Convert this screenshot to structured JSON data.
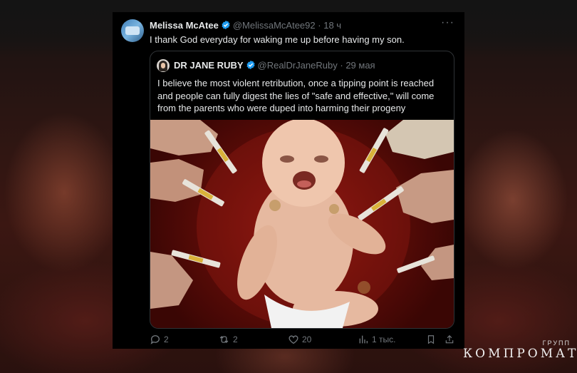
{
  "tweet": {
    "author_name": "Melissa McAtee",
    "author_handle": "@MelissaMcAtee92",
    "separator": "·",
    "time": "18 ч",
    "more_label": "···",
    "text": "I thank God everyday for waking me up before having my son."
  },
  "quoted_tweet": {
    "author_name": "DR JANE RUBY",
    "author_handle": "@RealDrJaneRuby",
    "separator": "·",
    "time": "29 мая",
    "text": "I believe the most violent retribution, once a tipping point is reached and people can fully digest the lies of \"safe and effective,\" will come from the parents who were duped into harming their progeny"
  },
  "actions": {
    "reply_count": "2",
    "retweet_count": "2",
    "like_count": "20",
    "views_count": "1 тыс."
  },
  "colors": {
    "card_background": "#000000",
    "text_primary": "#e7e9ea",
    "text_secondary": "#71767b",
    "verified_blue": "#1d9bf0",
    "border": "#2f3336"
  },
  "icons": [
    "verified-badge-icon",
    "more-icon",
    "reply-icon",
    "retweet-icon",
    "like-icon",
    "views-icon",
    "bookmark-icon",
    "share-icon"
  ],
  "watermark": {
    "small": "ГРУПП",
    "big": "КОМПРОМАТ"
  }
}
